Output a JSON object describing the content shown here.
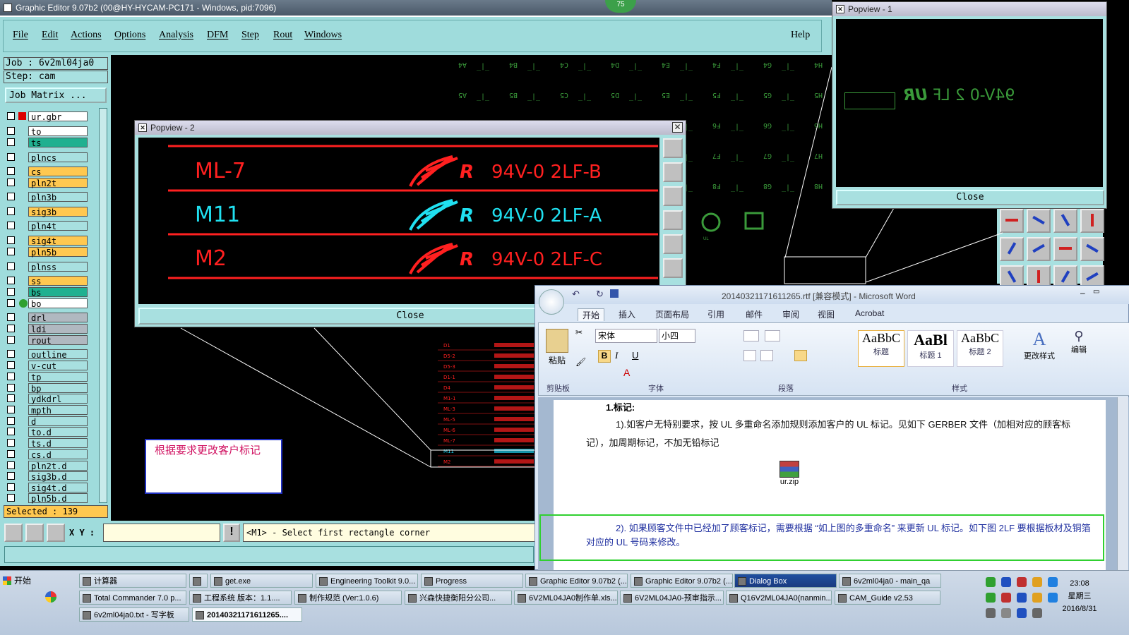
{
  "main_window": {
    "title": "Graphic Editor 9.07b2 (00@HY-HYCAM-PC171 - Windows, pid:7096)",
    "badge": "75",
    "menu": [
      "File",
      "Edit",
      "Actions",
      "Options",
      "Analysis",
      "DFM",
      "Step",
      "Rout",
      "Windows"
    ],
    "help": "Help"
  },
  "left_panel": {
    "job": "Job : 6v2ml04ja0",
    "step": "Step: cam",
    "job_matrix": "Job Matrix ...",
    "layers": [
      {
        "name": "ur.gbr",
        "color": "#ffffff"
      },
      {
        "name": "to",
        "color": "#ffffff"
      },
      {
        "name": "ts",
        "color": "#20b090"
      },
      {
        "name": "plncs",
        "color": "#a8e0e0"
      },
      {
        "name": "cs",
        "color": "#ffc850"
      },
      {
        "name": "pln2t",
        "color": "#ffc850"
      },
      {
        "name": "pln3b",
        "color": "#a8e0e0"
      },
      {
        "name": "sig3b",
        "color": "#ffc850"
      },
      {
        "name": "pln4t",
        "color": "#a8e0e0"
      },
      {
        "name": "sig4t",
        "color": "#ffc850"
      },
      {
        "name": "pln5b",
        "color": "#ffc850"
      },
      {
        "name": "plnss",
        "color": "#a8e0e0"
      },
      {
        "name": "ss",
        "color": "#ffc850"
      },
      {
        "name": "bs",
        "color": "#20b090"
      },
      {
        "name": "bo",
        "color": "#ffffff"
      },
      {
        "name": "drl",
        "color": "#b0b8c0"
      },
      {
        "name": "ldi",
        "color": "#b0b8c0"
      },
      {
        "name": "rout",
        "color": "#b0b8c0"
      },
      {
        "name": "outline",
        "color": "#a8e0e0"
      },
      {
        "name": "v-cut",
        "color": "#a8e0e0"
      },
      {
        "name": "tp",
        "color": "#a8e0e0"
      },
      {
        "name": "bp",
        "color": "#a8e0e0"
      },
      {
        "name": "ydkdrl",
        "color": "#a8e0e0"
      },
      {
        "name": "mpth",
        "color": "#a8e0e0"
      },
      {
        "name": "d",
        "color": "#a8e0e0"
      },
      {
        "name": "to.d",
        "color": "#a8e0e0"
      },
      {
        "name": "ts.d",
        "color": "#a8e0e0"
      },
      {
        "name": "cs.d",
        "color": "#a8e0e0"
      },
      {
        "name": "pln2t.d",
        "color": "#a8e0e0"
      },
      {
        "name": "sig3b.d",
        "color": "#a8e0e0"
      },
      {
        "name": "sig4t.d",
        "color": "#a8e0e0"
      },
      {
        "name": "pln5b.d",
        "color": "#a8e0e0"
      }
    ],
    "selected": "Selected : 139"
  },
  "status_bar": {
    "xy_label": "X Y :",
    "message": "<M1> - Select first rectangle corner"
  },
  "annotation_note": "根据要求更改客户标记",
  "popview2": {
    "title": "Popview - 2",
    "rows": [
      {
        "label": "ML-7",
        "marking": "94V-0 2LF-B",
        "color": "#ff2020"
      },
      {
        "label": "M11",
        "marking": "94V-0 2LF-A",
        "color": "#20e0f0"
      },
      {
        "label": "M2",
        "marking": "94V-0 2LF-C",
        "color": "#ff2020"
      }
    ],
    "close": "Close"
  },
  "popview1": {
    "title": "Popview - 1",
    "marking": "94V-0 2 LF",
    "close": "Close"
  },
  "word": {
    "title": "20140321171611265.rtf [兼容模式] - Microsoft Word",
    "tabs": [
      "开始",
      "插入",
      "页面布局",
      "引用",
      "邮件",
      "审阅",
      "视图",
      "Acrobat"
    ],
    "font_name": "宋体",
    "font_size": "小四",
    "paste": "粘贴",
    "groups": [
      "剪贴板",
      "字体",
      "段落",
      "样式"
    ],
    "styles": [
      {
        "preview": "AaBbC",
        "name": "标题"
      },
      {
        "preview": "AaBl",
        "name": "标题 1"
      },
      {
        "preview": "AaBbC",
        "name": "标题 2"
      }
    ],
    "change_style": "更改样式",
    "edit": "编辑",
    "heading": "1.标记:",
    "para1": "1).如客户无特别要求，按 UL 多重命名添加规则添加客户的 UL 标记。见如下 GERBER 文件（加相对应的顾客标记），加周期标记，不加无铅标记",
    "attachment": "ur.zip",
    "para2": "2). 如果顾客文件中已经加了顾客标记，需要根据 “如上图的多重命名” 来更新 UL 标记。如下图 2LF 要根据板材及铜箔对应的 UL 号码来修改。"
  },
  "taskbar": {
    "start": "开始",
    "row1": [
      "计算器",
      "",
      "get.exe",
      "Engineering Toolkit 9.0...",
      "Progress",
      "Graphic Editor 9.07b2 (...",
      "Graphic Editor 9.07b2 (...",
      "Dialog Box",
      "6v2ml04ja0 - main_qa"
    ],
    "row2": [
      "Total Commander 7.0 p...",
      "工程系统  版本：1.1....",
      "制作规范 (Ver:1.0.6)",
      "兴森快捷衡阳分公司...",
      "6V2ML04JA0制作单.xls...",
      "6V2ML04JA0-预审指示...",
      "Q16V2ML04JA0(nanmin...",
      "CAM_Guide v2.53"
    ],
    "row3": [
      "6v2ml04ja0.txt - 写字板",
      "20140321171611265...."
    ],
    "time": "23:08",
    "weekday": "星期三",
    "date": "2016/8/31"
  }
}
